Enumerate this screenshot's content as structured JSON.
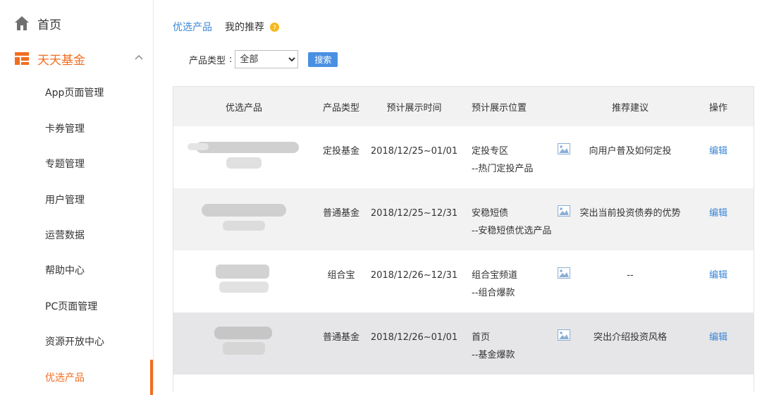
{
  "sidebar": {
    "home": {
      "label": "首页",
      "icon": "home-icon"
    },
    "fund": {
      "label": "天天基金",
      "icon": "store-icon"
    },
    "items": [
      {
        "label": "App页面管理"
      },
      {
        "label": "卡券管理"
      },
      {
        "label": "专题管理"
      },
      {
        "label": "用户管理"
      },
      {
        "label": "运营数据"
      },
      {
        "label": "帮助中心"
      },
      {
        "label": "PC页面管理"
      },
      {
        "label": "资源开放中心"
      },
      {
        "label": "优选产品",
        "active": true
      }
    ]
  },
  "tabs": [
    {
      "label": "优选产品",
      "active": true
    },
    {
      "label": "我的推荐"
    }
  ],
  "filter": {
    "label": "产品类型",
    "colon": ":",
    "selected": "全部",
    "search_label": "搜索"
  },
  "table": {
    "headers": [
      "优选产品",
      "产品类型",
      "预计展示时间",
      "预计展示位置",
      "推荐建议",
      "操作"
    ],
    "rows": [
      {
        "type": "定投基金",
        "time": "2018/12/25~01/01",
        "pos_main": "定投专区",
        "pos_sub": "--热门定投产品",
        "suggestion": "向用户普及如何定投",
        "action": "编辑"
      },
      {
        "type": "普通基金",
        "time": "2018/12/25~12/31",
        "pos_main": "安稳短债",
        "pos_sub": "--安稳短债优选产品",
        "suggestion": "突出当前投资债券的优势",
        "action": "编辑"
      },
      {
        "type": "组合宝",
        "time": "2018/12/26~12/31",
        "pos_main": "组合宝频道",
        "pos_sub": "--组合爆款",
        "suggestion": "--",
        "action": "编辑"
      },
      {
        "type": "普通基金",
        "time": "2018/12/26~01/01",
        "pos_main": "首页",
        "pos_sub": "--基金爆款",
        "suggestion": "突出介绍投资风格",
        "action": "编辑"
      }
    ]
  },
  "colors": {
    "accent": "#f26d21",
    "link": "#3a86d6",
    "button": "#4a90e2",
    "header_bg": "#f2f2f2"
  }
}
